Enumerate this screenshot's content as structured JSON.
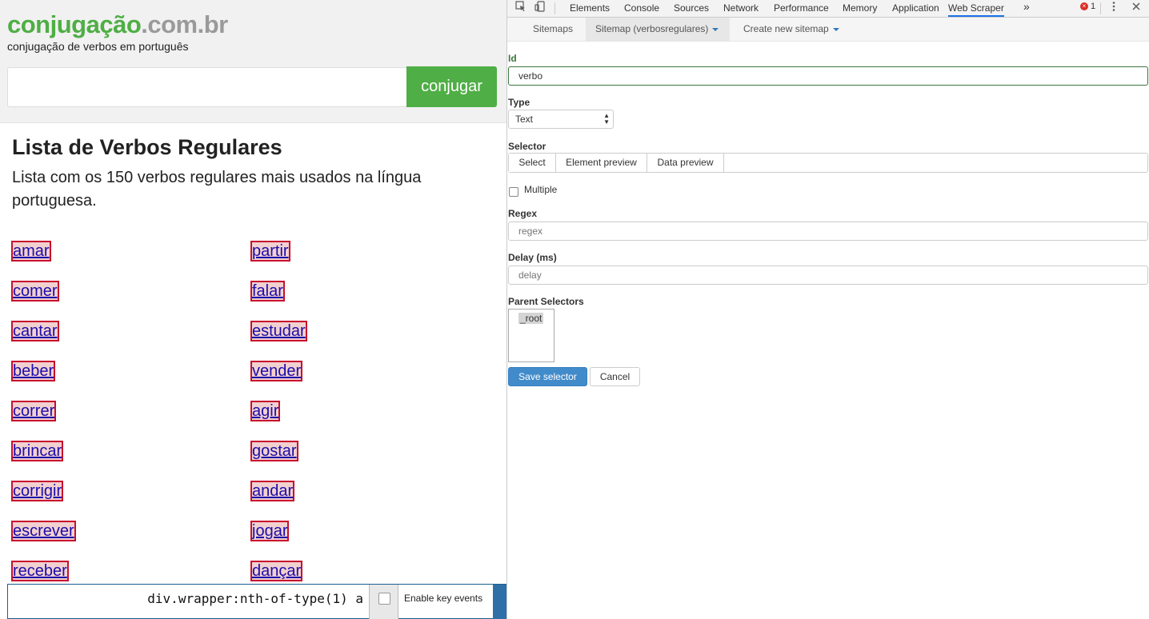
{
  "site": {
    "logo_main": "conjugação",
    "logo_suffix": ".com.br",
    "tagline": "conjugação de verbos em português",
    "search_placeholder": "",
    "search_button": "conjugar"
  },
  "content": {
    "title": "Lista de Verbos Regulares",
    "description": "Lista com os 150 verbos regulares mais usados na língua portuguesa.",
    "verbs_left": [
      "amar",
      "comer",
      "cantar",
      "beber",
      "correr",
      "brincar",
      "corrigir",
      "escrever",
      "receber"
    ],
    "verbs_right": [
      "partir",
      "falar",
      "estudar",
      "vender",
      "agir",
      "gostar",
      "andar",
      "jogar",
      "dançar"
    ]
  },
  "selector_bar": {
    "selector_text": "div.wrapper:nth-of-type(1) a",
    "enable_key_events": "Enable key events"
  },
  "devtools": {
    "tabs": [
      "Elements",
      "Console",
      "Sources",
      "Network",
      "Performance",
      "Memory",
      "Application",
      "Web Scraper"
    ],
    "active_tab": "Web Scraper",
    "more_icon": "»",
    "error_count": "1",
    "error_icon": "×"
  },
  "webscraper": {
    "nav": {
      "sitemaps": "Sitemaps",
      "current_sitemap": "Sitemap (verbosregulares)",
      "create_new": "Create new sitemap"
    },
    "form": {
      "id_label": "Id",
      "id_value": "verbo",
      "type_label": "Type",
      "type_value": "Text",
      "selector_label": "Selector",
      "select_button": "Select",
      "element_preview_button": "Element preview",
      "data_preview_button": "Data preview",
      "selector_value": "",
      "multiple_label": "Multiple",
      "multiple_checked": false,
      "regex_label": "Regex",
      "regex_placeholder": "regex",
      "delay_label": "Delay (ms)",
      "delay_placeholder": "delay",
      "parent_selectors_label": "Parent Selectors",
      "parent_selectors": [
        "_root"
      ],
      "save_button": "Save selector",
      "cancel_button": "Cancel"
    }
  },
  "colors": {
    "brand_green": "#4fae45",
    "logo_gray": "#9a9a9a",
    "link_blue": "#1a0dab",
    "highlight_border": "#c8102e",
    "primary_button": "#428bca",
    "valid_green": "#3c763d"
  }
}
